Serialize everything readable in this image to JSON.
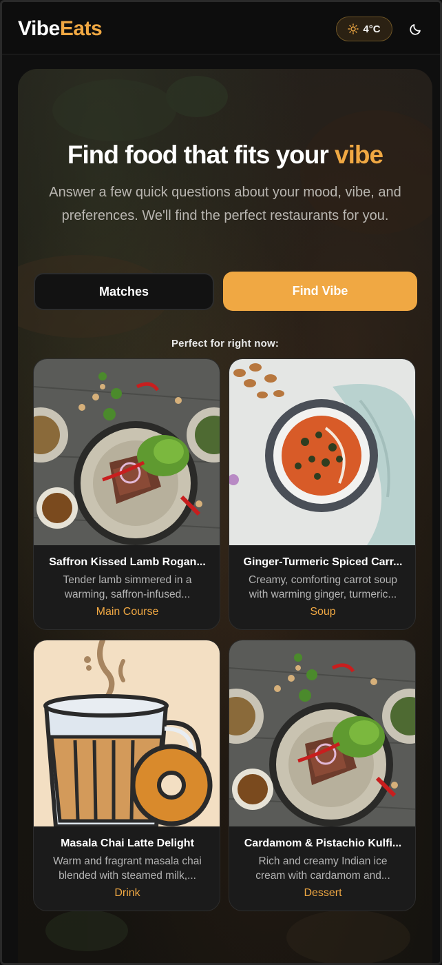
{
  "header": {
    "logo_part1": "Vibe",
    "logo_part2": "Eats",
    "weather": "4°C",
    "weather_icon": "sun-icon",
    "theme_icon": "moon-icon"
  },
  "hero": {
    "title_main": "Find food that fits your ",
    "title_accent": "vibe",
    "subtitle": "Answer a few quick questions about your mood, vibe, and preferences. We'll find the perfect restaurants for you.",
    "matches_label": "Matches",
    "find_vibe_label": "Find Vibe",
    "section_label": "Perfect for right now:"
  },
  "cards": [
    {
      "name": "Saffron Kissed Lamb Rogan...",
      "desc": "Tender lamb simmered in a warming, saffron-infused...",
      "category": "Main Course"
    },
    {
      "name": "Ginger-Turmeric Spiced Carr...",
      "desc": "Creamy, comforting carrot soup with warming ginger, turmeric...",
      "category": "Soup"
    },
    {
      "name": "Masala Chai Latte Delight",
      "desc": "Warm and fragrant masala chai blended with steamed milk,...",
      "category": "Drink"
    },
    {
      "name": "Cardamom & Pistachio Kulfi...",
      "desc": "Rich and creamy Indian ice cream with cardamom and...",
      "category": "Dessert"
    }
  ],
  "colors": {
    "accent": "#f0a843",
    "background": "#0f0f0f",
    "card": "#1b1b1b"
  }
}
